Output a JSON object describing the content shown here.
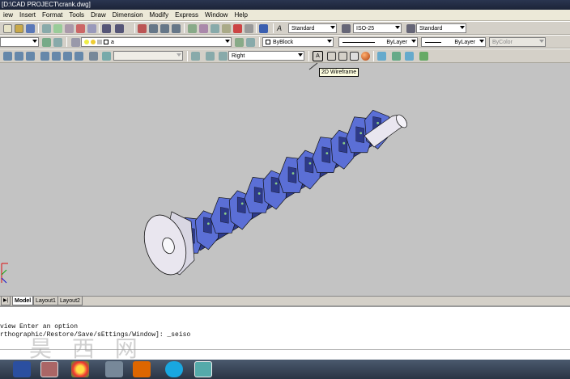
{
  "window": {
    "title": "[D:\\CAD PROJECT\\crank.dwg]"
  },
  "menu": [
    "iew",
    "Insert",
    "Format",
    "Tools",
    "Draw",
    "Dimension",
    "Modify",
    "Express",
    "Window",
    "Help"
  ],
  "styles": {
    "text_style": "Standard",
    "dim_style": "ISO-25",
    "table_style": "Standard"
  },
  "properties": {
    "layer_value": "a",
    "color": "ByBlock",
    "linetype": "ByLayer",
    "lineweight": "ByLayer",
    "plotstyle": "ByColor"
  },
  "views": {
    "named_view": "Right",
    "ucs_combo": ""
  },
  "tooltip": "2D Wireframe",
  "layout_tabs": [
    "Model",
    "Layout1",
    "Layout2"
  ],
  "command_lines": [
    "view Enter an option",
    "rthographic/Restore/Save/sEttings/Window]: _seiso"
  ],
  "watermark": "昊 西 网",
  "colors": {
    "viewport_bg": "#c3c3c3",
    "model_fill": "#5b6fd6",
    "model_dark": "#2e3a8a",
    "shaft_fill": "#e9e6ef"
  }
}
